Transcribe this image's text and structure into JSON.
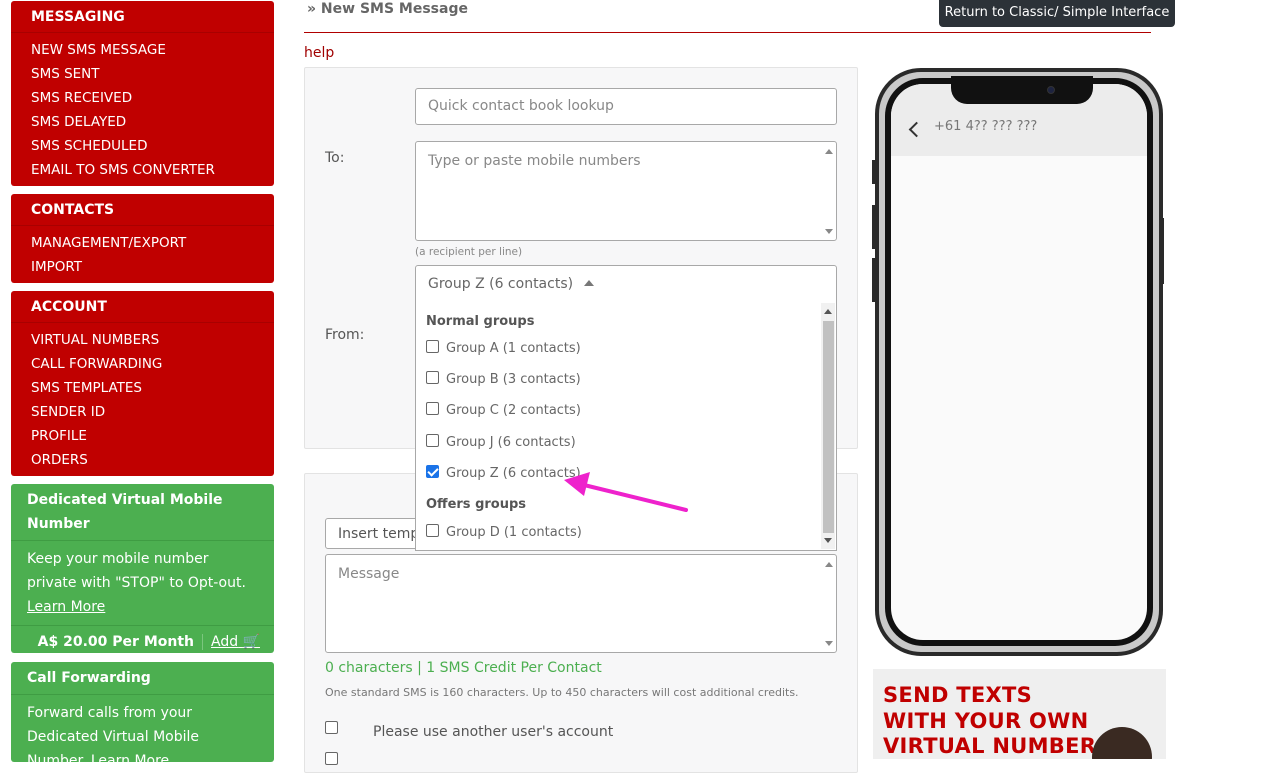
{
  "sidebar": {
    "messaging": {
      "heading": "MESSAGING",
      "items": [
        "NEW SMS MESSAGE",
        "SMS SENT",
        "SMS RECEIVED",
        "SMS DELAYED",
        "SMS SCHEDULED",
        "EMAIL TO SMS CONVERTER"
      ]
    },
    "contacts": {
      "heading": "CONTACTS",
      "items": [
        "MANAGEMENT/EXPORT",
        "IMPORT"
      ]
    },
    "account": {
      "heading": "ACCOUNT",
      "items": [
        "VIRTUAL NUMBERS",
        "CALL FORWARDING",
        "SMS TEMPLATES",
        "SENDER ID",
        "PROFILE",
        "ORDERS"
      ]
    },
    "virtual_number_promo": {
      "title": "Dedicated Virtual Mobile Number",
      "body": "Keep your mobile number private with \"STOP\" to Opt-out.",
      "link": "Learn More",
      "price": "A$ 20.00 Per Month",
      "add": "Add"
    },
    "call_forwarding_promo": {
      "title": "Call Forwarding",
      "body": "Forward calls from your Dedicated Virtual Mobile Number.",
      "link": "Learn More"
    }
  },
  "header": {
    "title": "» New SMS Message",
    "classic_button": "Return to Classic/ Simple Interface",
    "help": "help"
  },
  "form": {
    "lookup_placeholder": "Quick contact book lookup",
    "to_label": "To:",
    "numbers_placeholder": "Type or paste mobile numbers",
    "numbers_hint": "(a recipient per line)",
    "group_selected": "Group Z (6 contacts)",
    "from_label": "From:",
    "template_placeholder": "Insert templ",
    "message_placeholder": "Message",
    "counter": "0 characters | 1 SMS Credit Per Contact",
    "note": "One standard SMS is 160 characters. Up to 450 characters will cost additional credits.",
    "other_account_label": "Please use another user's account"
  },
  "dropdown": {
    "normal_heading": "Normal groups",
    "normal": [
      {
        "label": "Group A (1 contacts)",
        "checked": false
      },
      {
        "label": "Group B (3 contacts)",
        "checked": false
      },
      {
        "label": "Group C (2 contacts)",
        "checked": false
      },
      {
        "label": "Group J (6 contacts)",
        "checked": false
      },
      {
        "label": "Group Z (6 contacts)",
        "checked": true
      }
    ],
    "offers_heading": "Offers groups",
    "offers": [
      {
        "label": "Group D (1 contacts)",
        "checked": false
      }
    ]
  },
  "phone": {
    "number": "+61 4?? ??? ???"
  },
  "ad": {
    "lines": [
      "SEND TEXTS",
      "WITH YOUR OWN",
      "VIRTUAL NUMBER"
    ]
  },
  "colors": {
    "menu_red": "#c00000",
    "promo_green": "#4caf50",
    "arrow_magenta": "#ee22cc",
    "checkbox_blue": "#1a73e8"
  }
}
